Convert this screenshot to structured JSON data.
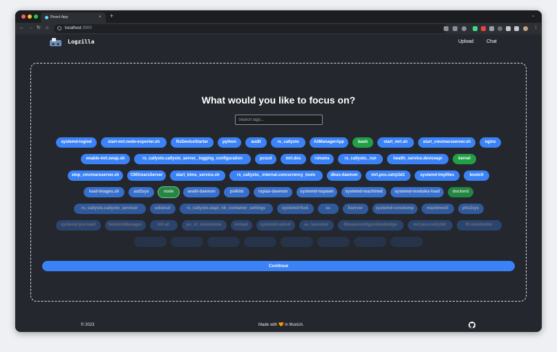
{
  "browser": {
    "tab_title": "React App",
    "tab_close": "×",
    "new_tab": "+",
    "tab_menu": "⌄",
    "url_host": "localhost",
    "url_port": ":3000",
    "back": "←",
    "forward": "→",
    "reload": "↻",
    "home": "⌂"
  },
  "header": {
    "brand": "Logzilla",
    "nav": [
      "Upload",
      "Chat"
    ]
  },
  "main": {
    "heading": "What would you like to focus on?",
    "search_placeholder": "Search tags...",
    "rows": [
      {
        "opacity": 1,
        "tags": [
          {
            "label": "systemd-logind",
            "color": "blue"
          },
          {
            "label": "start-mrt.node-exporter.sh",
            "color": "blue"
          },
          {
            "label": "RsDeviceStarter",
            "color": "blue"
          },
          {
            "label": "python",
            "color": "blue"
          },
          {
            "label": "audit",
            "color": "blue"
          },
          {
            "label": "rs_callysto",
            "color": "blue"
          },
          {
            "label": "AllManagerApp",
            "color": "blue"
          },
          {
            "label": "bash",
            "color": "green"
          },
          {
            "label": "start_mrt.sh",
            "color": "blue"
          },
          {
            "label": "start_cmxmarsserver.sh",
            "color": "blue"
          },
          {
            "label": "nginx",
            "color": "blue"
          }
        ]
      },
      {
        "opacity": 1,
        "tags": [
          {
            "label": "enable-mrt.swap.sh",
            "color": "blue"
          },
          {
            "label": "rs_callysto.callysto_server._logging_configuration",
            "color": "blue"
          },
          {
            "label": "pcscd",
            "color": "blue"
          },
          {
            "label": "mrt.dos",
            "color": "blue"
          },
          {
            "label": "rshums",
            "color": "blue"
          },
          {
            "label": "rs_callysto._run",
            "color": "blue"
          },
          {
            "label": "health_service.deviceapi",
            "color": "blue"
          },
          {
            "label": "kernel",
            "color": "green"
          }
        ]
      },
      {
        "opacity": 1,
        "tags": [
          {
            "label": "stop_cmxmarsserver.sh",
            "color": "blue"
          },
          {
            "label": "CMXmarsServer",
            "color": "blue"
          },
          {
            "label": "start_blms_service.sh",
            "color": "blue"
          },
          {
            "label": "rs_callysto._internal.concurrency_tools",
            "color": "blue"
          },
          {
            "label": "dbus-daemon",
            "color": "blue"
          },
          {
            "label": "mrt.pos.catrp3d1",
            "color": "blue"
          },
          {
            "label": "systemd-tmpfiles",
            "color": "blue"
          },
          {
            "label": "bootctl",
            "color": "blue"
          }
        ]
      },
      {
        "opacity": 0.8,
        "tags": [
          {
            "label": "load-images.sh",
            "color": "blue"
          },
          {
            "label": "ast2sys",
            "color": "blue"
          },
          {
            "label": "node",
            "color": "green",
            "selected": true
          },
          {
            "label": "avahi-daemon",
            "color": "blue"
          },
          {
            "label": "polkitd",
            "color": "blue"
          },
          {
            "label": "rspias-daemon",
            "color": "blue"
          },
          {
            "label": "systemd-nspawn",
            "color": "blue"
          },
          {
            "label": "systemd-machined",
            "color": "blue"
          },
          {
            "label": "systemd-modules-load",
            "color": "blue"
          },
          {
            "label": "dockerd",
            "color": "green"
          }
        ]
      },
      {
        "opacity": 0.55,
        "tags": [
          {
            "label": "rs_callysto.callysto_servicer",
            "color": "blue"
          },
          {
            "label": "udisksd",
            "color": "blue"
          },
          {
            "label": "rs_callysto.slapi_nb_container_settings",
            "color": "blue"
          },
          {
            "label": "systemd-fsck",
            "color": "blue"
          },
          {
            "label": "su",
            "color": "blue"
          },
          {
            "label": "Xserver",
            "color": "blue"
          },
          {
            "label": "systemd-coredump",
            "color": "blue"
          },
          {
            "label": "machinectl",
            "color": "blue"
          },
          {
            "label": "phc2sys",
            "color": "blue"
          }
        ]
      },
      {
        "opacity": 0.32,
        "tags": [
          {
            "label": "systemd-journald",
            "color": "blue"
          },
          {
            "label": "NetworkManager",
            "color": "blue"
          },
          {
            "label": "kill all",
            "color": "blue"
          },
          {
            "label": "pu_id_standalone",
            "color": "blue"
          },
          {
            "label": "snmpd",
            "color": "blue"
          },
          {
            "label": "systemd-udevd",
            "color": "blue"
          },
          {
            "label": "su_launcher",
            "color": "blue"
          },
          {
            "label": "filesamconfigurationbridge",
            "color": "blue"
          },
          {
            "label": "mrt.pos.catrp3dr",
            "color": "blue"
          },
          {
            "label": "fit installation",
            "color": "blue"
          }
        ]
      },
      {
        "opacity": 0.14,
        "tags": [
          {
            "label": "",
            "color": "blue"
          },
          {
            "label": "",
            "color": "blue"
          },
          {
            "label": "",
            "color": "blue"
          },
          {
            "label": "",
            "color": "blue"
          },
          {
            "label": "",
            "color": "blue"
          },
          {
            "label": "",
            "color": "blue"
          },
          {
            "label": "",
            "color": "blue"
          },
          {
            "label": "",
            "color": "blue"
          }
        ]
      }
    ],
    "continue_label": "Continue"
  },
  "footer": {
    "copyright": "© 2023",
    "made_with": "Made with 🧡 in Munich."
  },
  "colors": {
    "accent_blue": "#3b82f6",
    "accent_green": "#22a047",
    "background": "#24272d"
  }
}
